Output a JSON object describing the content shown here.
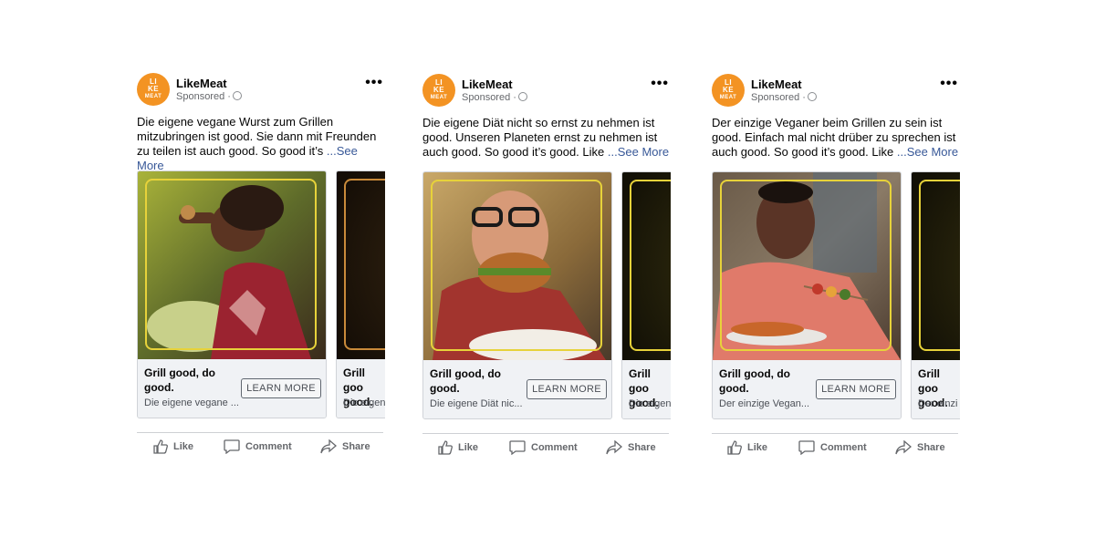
{
  "posts": [
    {
      "page_name": "LikeMeat",
      "logo_top": "LI",
      "logo_mid": "KE",
      "logo_bottom": "MEAT",
      "sponsored": "Sponsored ·",
      "text": "Die eigene vegane Wurst zum Grillen mitzubringen ist good. Sie dann mit Freunden zu teilen ist auch good. So good it’s",
      "see_more": "...See More",
      "cards": [
        {
          "headline": "Grill good, do good.",
          "description": "Die eigene vegane ...",
          "cta": "LEARN MORE"
        },
        {
          "headline": "Grill goo good.",
          "description": "Die eigen",
          "cta": ""
        }
      ],
      "actions": {
        "like": "Like",
        "comment": "Comment",
        "share": "Share"
      }
    },
    {
      "page_name": "LikeMeat",
      "logo_top": "LI",
      "logo_mid": "KE",
      "logo_bottom": "MEAT",
      "sponsored": "Sponsored ·",
      "text": "Die eigene Diät nicht so ernst zu nehmen ist good. Unseren Planeten ernst zu nehmen ist auch good. So good it’s good. Like",
      "see_more": "...See More",
      "cards": [
        {
          "headline": "Grill good, do good.",
          "description": "Die eigene Diät nic...",
          "cta": "LEARN MORE"
        },
        {
          "headline": "Grill goo good.",
          "description": "Die eigen",
          "cta": ""
        }
      ],
      "actions": {
        "like": "Like",
        "comment": "Comment",
        "share": "Share"
      }
    },
    {
      "page_name": "LikeMeat",
      "logo_top": "LI",
      "logo_mid": "KE",
      "logo_bottom": "MEAT",
      "sponsored": "Sponsored ·",
      "text": "Der einzige Veganer beim Grillen zu sein ist good. Einfach mal nicht drüber zu sprechen ist auch good. So good it’s good. Like",
      "see_more": "...See More",
      "cards": [
        {
          "headline": "Grill good, do good.",
          "description": "Der einzige Vegan...",
          "cta": "LEARN MORE"
        },
        {
          "headline": "Grill goo good.",
          "description": "Der einzi",
          "cta": ""
        }
      ],
      "actions": {
        "like": "Like",
        "comment": "Comment",
        "share": "Share"
      }
    }
  ],
  "colors": {
    "brand_orange": "#f39323",
    "frame_yellow": "#e7d23a",
    "link": "#385898"
  }
}
